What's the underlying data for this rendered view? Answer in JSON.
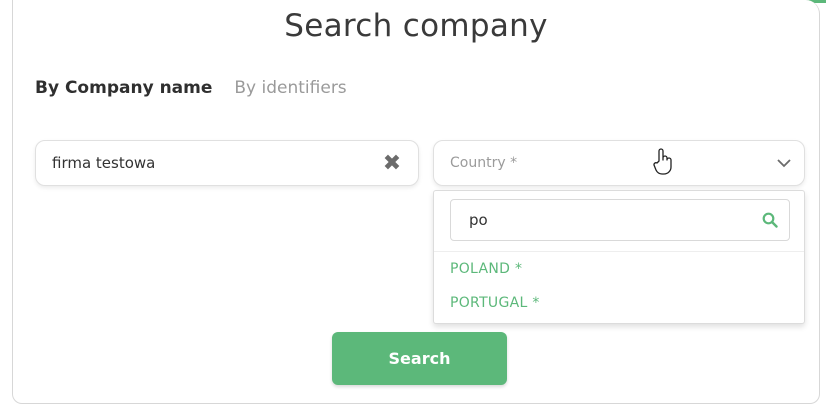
{
  "page": {
    "title": "Search company"
  },
  "tabs": [
    {
      "label": "By Company name",
      "active": true
    },
    {
      "label": "By identifiers",
      "active": false
    }
  ],
  "company_input": {
    "value": "firma testowa",
    "clear_icon": "close-x-icon"
  },
  "country_select": {
    "placeholder": "Country *",
    "chevron_icon": "chevron-down-icon",
    "dropdown": {
      "search_value": "po",
      "search_icon": "search-icon",
      "options": [
        "POLAND *",
        "PORTUGAL *"
      ]
    }
  },
  "search_button": {
    "label": "Search"
  },
  "colors": {
    "accent": "#5cb87a",
    "text_dark": "#2f2f2f",
    "text_muted": "#9a9a9a"
  }
}
